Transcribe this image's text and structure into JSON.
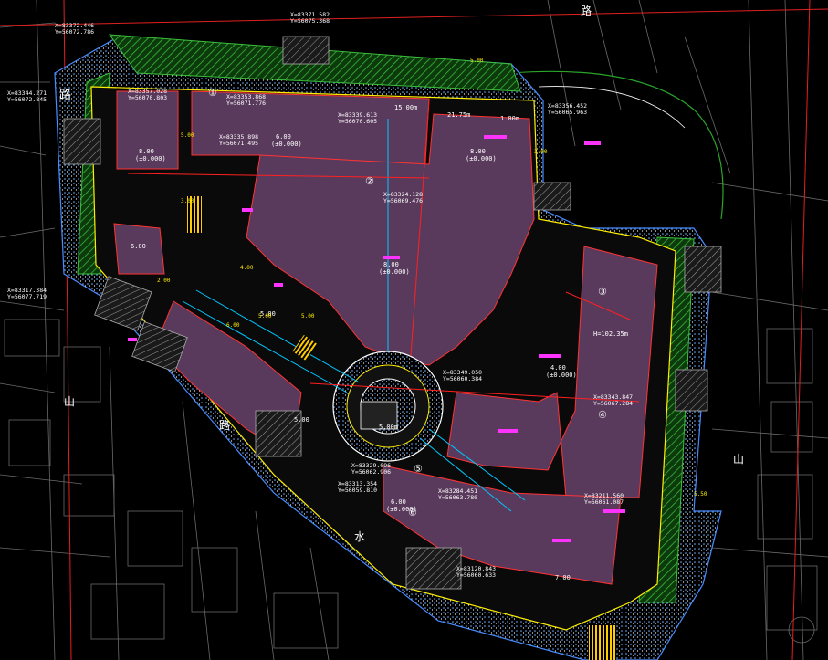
{
  "colors": {
    "background": "#000000",
    "building_fill": "#5a3a5c",
    "building_edge": "#ff3333",
    "green_hatch": "#2aa52a",
    "road_line": "#ffffff",
    "context_line": "#7a7a7a",
    "dim_text": "#ffffff",
    "coord_text": "#ffffff",
    "axis_marker": "#ffffff",
    "magenta": "#ff33ff",
    "cyan": "#00c8ff",
    "yellow": "#ffee00",
    "blue_speck": "#4a8cff"
  },
  "road_labels": [
    {
      "id": "road-label-top-left",
      "text": "路"
    },
    {
      "id": "road-label-top-right",
      "text": "路"
    },
    {
      "id": "road-label-left-mountain",
      "text": "山"
    },
    {
      "id": "road-label-right-mountain",
      "text": "山"
    },
    {
      "id": "road-label-street",
      "text": "路"
    },
    {
      "id": "road-label-water",
      "text": "水"
    }
  ],
  "coordinates": [
    {
      "id": "coord-top-center",
      "x": "X=83371.582",
      "y": "Y=56075.368"
    },
    {
      "id": "coord-top-left",
      "x": "X=83372.446",
      "y": "Y=56072.786"
    },
    {
      "id": "coord-left-edge",
      "x": "X=83344.271",
      "y": "Y=56072.845"
    },
    {
      "id": "coord-building-a",
      "x": "X=83357.028",
      "y": "Y=56070.803"
    },
    {
      "id": "coord-building-b",
      "x": "X=83353.868",
      "y": "Y=56071.776"
    },
    {
      "id": "coord-building-c",
      "x": "X=83335.898",
      "y": "Y=56071.495"
    },
    {
      "id": "coord-building-d",
      "x": "X=83339.613",
      "y": "Y=56070.605"
    },
    {
      "id": "coord-center",
      "x": "X=83324.128",
      "y": "Y=56069.476"
    },
    {
      "id": "coord-right-top",
      "x": "X=83356.452",
      "y": "Y=56065.963"
    },
    {
      "id": "coord-right-mid",
      "x": "X=83343.847",
      "y": "Y=56067.284"
    },
    {
      "id": "coord-circle",
      "x": "X=83349.050",
      "y": "Y=56060.384"
    },
    {
      "id": "coord-bottom-left",
      "x": "X=83329.096",
      "y": "Y=56062.906"
    },
    {
      "id": "coord-bottom-mid",
      "x": "X=83313.354",
      "y": "Y=56059.810"
    },
    {
      "id": "coord-bottom-right",
      "x": "X=83284.451",
      "y": "Y=56063.780"
    },
    {
      "id": "coord-right-low",
      "x": "X=83211.560",
      "y": "Y=56061.087"
    },
    {
      "id": "coord-bottom-far",
      "x": "X=83120.843",
      "y": "Y=56060.633"
    },
    {
      "id": "coord-west",
      "x": "X=83317.384",
      "y": "Y=56077.719"
    }
  ],
  "dimensions": [
    {
      "id": "dim-top-strip",
      "text": "15.00m"
    },
    {
      "id": "dim-top-mid",
      "text": "21.75m"
    },
    {
      "id": "dim-top-right",
      "text": "1.00m"
    },
    {
      "id": "dim-right-block",
      "text": "H=102.35m"
    },
    {
      "id": "dim-bottom-circle",
      "text": "5.00m"
    },
    {
      "id": "dim-elev-a",
      "text": "8.00"
    },
    {
      "id": "dim-elev-a-sub",
      "text": "(±0.000)"
    },
    {
      "id": "dim-elev-b",
      "text": "6.00"
    },
    {
      "id": "dim-elev-b-sub",
      "text": "(±0.000)"
    },
    {
      "id": "dim-elev-c",
      "text": "8.00"
    },
    {
      "id": "dim-elev-c-sub",
      "text": "(±0.000)"
    },
    {
      "id": "dim-elev-d",
      "text": "4.00"
    },
    {
      "id": "dim-elev-d-sub",
      "text": "(±0.000)"
    },
    {
      "id": "dim-elev-e",
      "text": "8.00"
    },
    {
      "id": "dim-elev-e-sub",
      "text": "(±0.000)"
    },
    {
      "id": "dim-elev-f",
      "text": "6.00"
    },
    {
      "id": "dim-elev-f-sub",
      "text": "(±0.000)"
    },
    {
      "id": "dim-elev-g",
      "text": "5.00"
    },
    {
      "id": "dim-elev-h",
      "text": "5.00"
    },
    {
      "id": "dim-elev-i",
      "text": "7.00"
    },
    {
      "id": "dim-elev-j",
      "text": "6.00"
    }
  ],
  "axis_markers": [
    {
      "id": "axis-marker-1",
      "text": "①"
    },
    {
      "id": "axis-marker-2",
      "text": "②"
    },
    {
      "id": "axis-marker-3",
      "text": "③"
    },
    {
      "id": "axis-marker-4",
      "text": "④"
    },
    {
      "id": "axis-marker-5",
      "text": "⑤"
    },
    {
      "id": "axis-marker-6",
      "text": "⑥"
    }
  ],
  "small_labels": [
    {
      "id": "small-label-1",
      "text": "5.00"
    },
    {
      "id": "small-label-2",
      "text": "5.00"
    },
    {
      "id": "small-label-3",
      "text": "3.00"
    },
    {
      "id": "small-label-4",
      "text": "5.00"
    },
    {
      "id": "small-label-5",
      "text": "6.00"
    },
    {
      "id": "small-label-6",
      "text": "2.00"
    },
    {
      "id": "small-label-7",
      "text": "4.00"
    },
    {
      "id": "small-label-8",
      "text": "5.00"
    },
    {
      "id": "small-label-9",
      "text": "5.50"
    },
    {
      "id": "small-label-10",
      "text": "3.00"
    }
  ]
}
